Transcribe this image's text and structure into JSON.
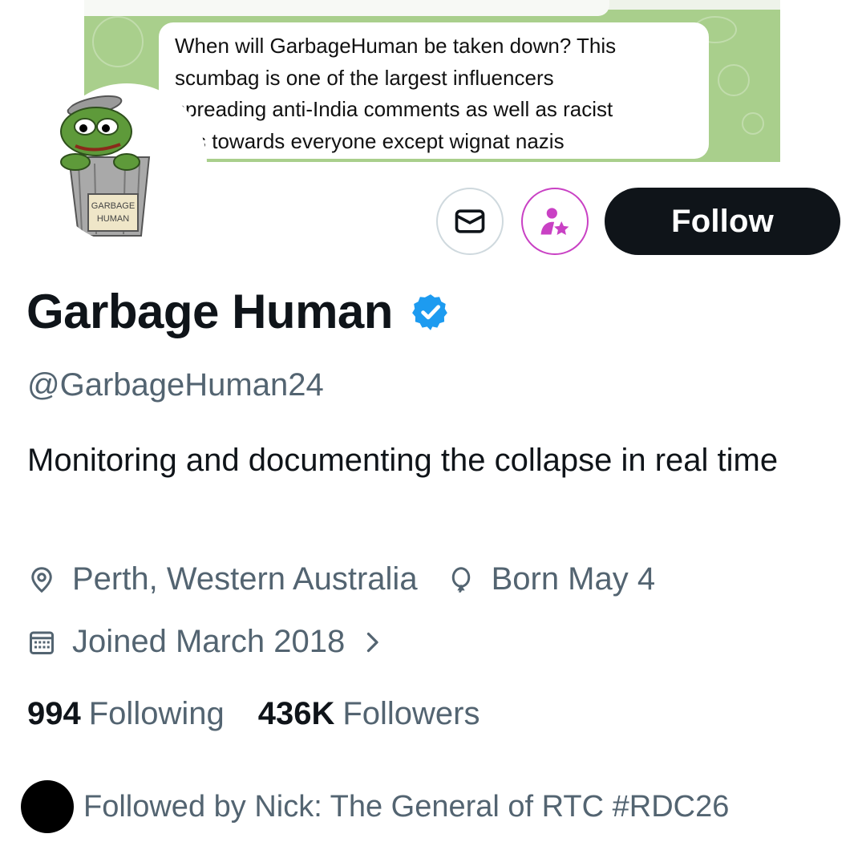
{
  "banner": {
    "chat_message": "When will GarbageHuman be taken down? This scumbag is one of the largest influencers spreading anti-India comments as well as racist lies towards everyone except wignat nazis",
    "chat_lines": [
      "When will GarbageHuman be taken down? This",
      "scumbag is one of the largest influencers",
      "spreading anti-India comments as well as racist",
      "lies towards everyone except wignat nazis"
    ]
  },
  "avatar": {
    "sign_text": "GARBAGE HUMAN",
    "sign_line1": "GARBAGE",
    "sign_line2": "HUMAN"
  },
  "actions": {
    "message_icon": "envelope-icon",
    "subscribe_icon": "person-star-icon",
    "follow_label": "Follow"
  },
  "profile": {
    "display_name": "Garbage Human",
    "verified": true,
    "handle": "@GarbageHuman24",
    "bio": "Monitoring and documenting the collapse in real time",
    "location": "Perth, Western Australia",
    "birthday": "Born May 4",
    "joined": "Joined March 2018"
  },
  "stats": {
    "following_count": "994",
    "following_label": "Following",
    "followers_count": "436K",
    "followers_label": "Followers"
  },
  "followed_by": "Followed by Nick: The General of RTC #RDC26",
  "colors": {
    "follow_bg": "#0f1419",
    "secondary_text": "#536471",
    "verified_blue": "#1d9bf0",
    "subscribe_purple": "#c941c4",
    "banner_green": "#a9cf8c"
  }
}
